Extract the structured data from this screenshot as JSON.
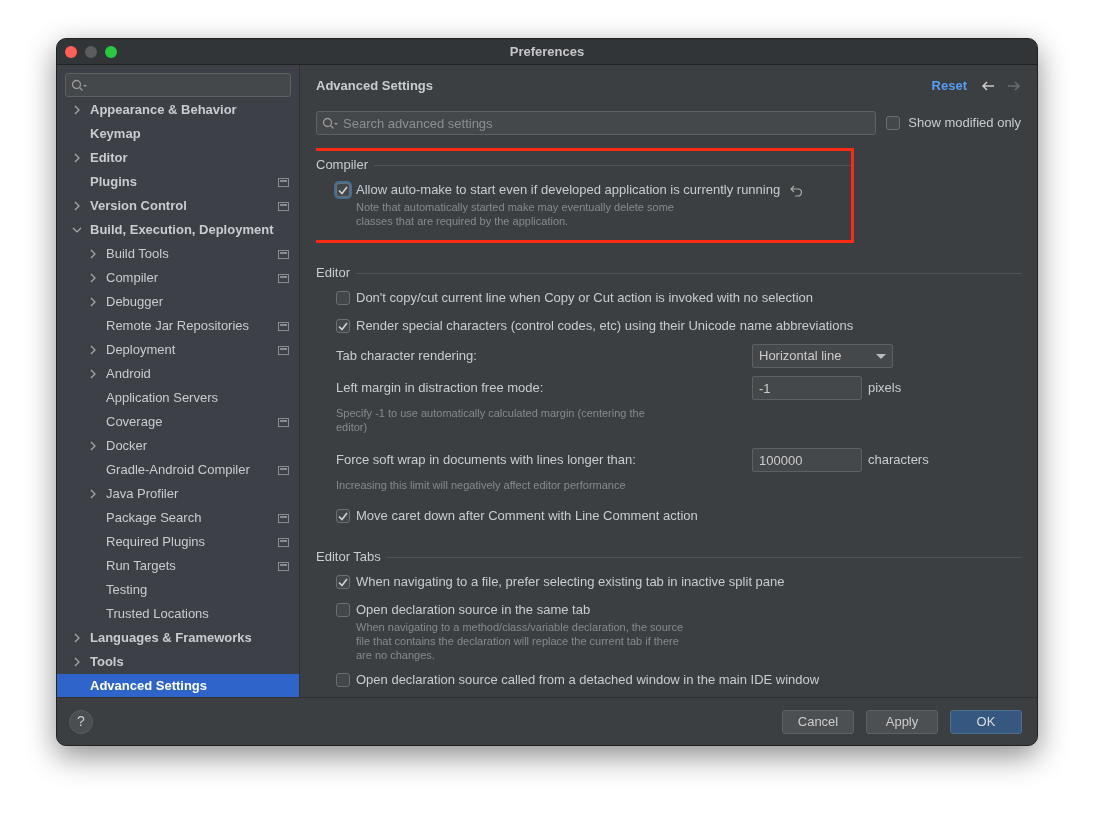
{
  "window": {
    "title": "Preferences"
  },
  "sidebar": {
    "items": [
      {
        "label": "Appearance & Behavior",
        "expanded": false,
        "selected": false
      },
      {
        "label": "Keymap",
        "selected": false
      },
      {
        "label": "Editor",
        "expanded": false,
        "selected": false
      },
      {
        "label": "Plugins",
        "project_icon": true,
        "selected": false
      },
      {
        "label": "Version Control",
        "expanded": false,
        "project_icon": true,
        "selected": false
      },
      {
        "label": "Build, Execution, Deployment",
        "expanded": true,
        "selected": false,
        "children": [
          {
            "label": "Build Tools",
            "expanded": false,
            "project_icon": true,
            "selected": false
          },
          {
            "label": "Compiler",
            "expanded": false,
            "project_icon": true,
            "selected": false
          },
          {
            "label": "Debugger",
            "expanded": false,
            "selected": false
          },
          {
            "label": "Remote Jar Repositories",
            "project_icon": true,
            "selected": false
          },
          {
            "label": "Deployment",
            "expanded": false,
            "project_icon": true,
            "selected": false
          },
          {
            "label": "Android",
            "expanded": false,
            "selected": false
          },
          {
            "label": "Application Servers",
            "selected": false
          },
          {
            "label": "Coverage",
            "project_icon": true,
            "selected": false
          },
          {
            "label": "Docker",
            "expanded": false,
            "selected": false
          },
          {
            "label": "Gradle-Android Compiler",
            "project_icon": true,
            "selected": false
          },
          {
            "label": "Java Profiler",
            "expanded": false,
            "selected": false
          },
          {
            "label": "Package Search",
            "project_icon": true,
            "selected": false
          },
          {
            "label": "Required Plugins",
            "project_icon": true,
            "selected": false
          },
          {
            "label": "Run Targets",
            "project_icon": true,
            "selected": false
          },
          {
            "label": "Testing",
            "selected": false
          },
          {
            "label": "Trusted Locations",
            "selected": false
          }
        ]
      },
      {
        "label": "Languages & Frameworks",
        "expanded": false,
        "selected": false
      },
      {
        "label": "Tools",
        "expanded": false,
        "selected": false
      },
      {
        "label": "Advanced Settings",
        "selected": true
      }
    ]
  },
  "content": {
    "title": "Advanced Settings",
    "reset": "Reset",
    "search": {
      "placeholder": "Search advanced settings"
    },
    "show_modified": {
      "label": "Show modified only",
      "checked": false
    },
    "sections": [
      {
        "title": "Compiler",
        "highlighted": true,
        "settings": [
          {
            "kind": "checkbox",
            "label": "Allow auto-make to start even if developed application is currently running",
            "checked": true,
            "modified": true,
            "note": "Note that automatically started make may eventually delete some classes that are required by the application."
          }
        ]
      },
      {
        "title": "Editor",
        "highlighted": false,
        "settings": [
          {
            "kind": "checkbox",
            "label": "Don't copy/cut current line when Copy or Cut action is invoked with no selection",
            "checked": false,
            "modified": false
          },
          {
            "kind": "checkbox",
            "label": "Render special characters (control codes, etc) using their Unicode name abbreviations",
            "checked": true,
            "modified": false
          },
          {
            "kind": "select",
            "label": "Tab character rendering:",
            "value": "Horizontal line"
          },
          {
            "kind": "number",
            "label": "Left margin in distraction free mode:",
            "value": "-1",
            "unit": "pixels",
            "note": "Specify -1 to use automatically calculated margin (centering the editor)"
          },
          {
            "kind": "number",
            "label": "Force soft wrap in documents with lines longer than:",
            "value": "100000",
            "unit": "characters",
            "note": "Increasing this limit will negatively affect editor performance"
          },
          {
            "kind": "checkbox",
            "label": "Move caret down after Comment with Line Comment action",
            "checked": true,
            "modified": false
          }
        ]
      },
      {
        "title": "Editor Tabs",
        "highlighted": false,
        "settings": [
          {
            "kind": "checkbox",
            "label": "When navigating to a file, prefer selecting existing tab in inactive split pane",
            "checked": true,
            "modified": false
          },
          {
            "kind": "checkbox",
            "label": "Open declaration source in the same tab",
            "checked": false,
            "modified": false,
            "note": "When navigating to a method/class/variable declaration, the source file that contains the declaration will replace the current tab if there are no changes."
          },
          {
            "kind": "checkbox",
            "label": "Open declaration source called from a detached window in the main IDE window",
            "checked": false,
            "modified": false
          }
        ]
      }
    ]
  },
  "help": "?",
  "buttons": [
    {
      "label": "Cancel",
      "default": false
    },
    {
      "label": "Apply",
      "default": false
    },
    {
      "label": "OK",
      "default": true
    }
  ]
}
